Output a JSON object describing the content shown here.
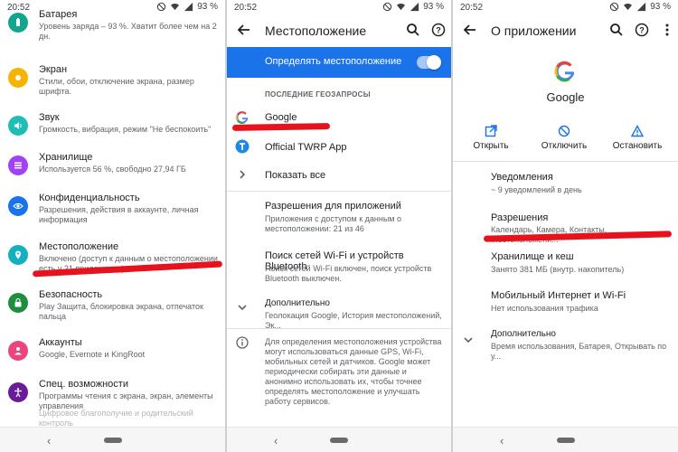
{
  "status": {
    "time": "20:52",
    "battery": "93 %"
  },
  "colors": {
    "accent": "#1a73e8",
    "mark": "#e8121d"
  },
  "settings_list": {
    "items": [
      {
        "icon": "battery-icon",
        "color": "#12a58d",
        "title": "Батарея",
        "subtitle": "Уровень заряда – 93 %. Хватит более чем на 2 дн."
      },
      {
        "icon": "display-icon",
        "color": "#f4b400",
        "title": "Экран",
        "subtitle": "Стили, обои, отключение экрана, размер шрифта."
      },
      {
        "icon": "sound-icon",
        "color": "#1fbeb5",
        "title": "Звук",
        "subtitle": "Громкость, вибрация, режим \"Не беспокоить\""
      },
      {
        "icon": "storage-icon",
        "color": "#a142f4",
        "title": "Хранилище",
        "subtitle": "Используется 56 %, свободно 27,94 ГБ"
      },
      {
        "icon": "privacy-icon",
        "color": "#1a73e8",
        "title": "Конфиденциальность",
        "subtitle": "Разрешения, действия в аккаунте, личная информация"
      },
      {
        "icon": "location-icon",
        "color": "#13b1bf",
        "title": "Местоположение",
        "subtitle": "Включено (доступ к данным о местоположении есть у 21 приложения)"
      },
      {
        "icon": "lock-icon",
        "color": "#1e8e3e",
        "title": "Безопасность",
        "subtitle": "Play Защита, блокировка экрана, отпечаток пальца"
      },
      {
        "icon": "accounts-icon",
        "color": "#e8467c",
        "title": "Аккаунты",
        "subtitle": "Google, Evernote и KingRoot"
      },
      {
        "icon": "accessibility-icon",
        "color": "#6a1b9a",
        "title": "Спец. возможности",
        "subtitle": "Программы чтения с экрана, экран, элементы управления"
      }
    ],
    "partial_last": "Цифровое благополучие и родительский контроль"
  },
  "location": {
    "title": "Местоположение",
    "toggle_label": "Определять местоположение",
    "section": "ПОСЛЕДНИЕ ГЕОЗАПРОСЫ",
    "apps": [
      "Google",
      "Official TWRP App"
    ],
    "show_all": "Показать все",
    "app_permissions": {
      "title": "Разрешения для приложений",
      "subtitle": "Приложения с доступом к данным о местоположении: 21 из 46"
    },
    "wifi_scan": {
      "title": "Поиск сетей Wi-Fi и устройств Bluetooth",
      "subtitle": "Поиск сетей Wi-Fi включен, поиск устройств Bluetooth выключен."
    },
    "advanced": {
      "title": "Дополнительно",
      "subtitle": "Геолокация Google, История местоположений, Эк..."
    },
    "info": "Для определения местоположения устройства могут использоваться данные GPS, Wi-Fi, мобильных сетей и датчиков. Google может периодически собирать эти данные и анонимно использовать их, чтобы точнее определять местоположение и улучшать работу сервисов."
  },
  "app_info": {
    "title": "О приложении",
    "app_name": "Google",
    "actions": [
      "Открыть",
      "Отключить",
      "Остановить"
    ],
    "rows": [
      {
        "title": "Уведомления",
        "subtitle": "~ 9 уведомлений в день"
      },
      {
        "title": "Разрешения",
        "subtitle": "Календарь, Камера, Контакты, Местоположени..."
      },
      {
        "title": "Хранилище и кеш",
        "subtitle": "Занято 381 МБ (внутр. накопитель)"
      },
      {
        "title": "Мобильный Интернет и Wi-Fi",
        "subtitle": "Нет использования трафика"
      },
      {
        "title": "Дополнительно",
        "subtitle": "Время использования, Батарея, Открывать по у..."
      }
    ]
  }
}
